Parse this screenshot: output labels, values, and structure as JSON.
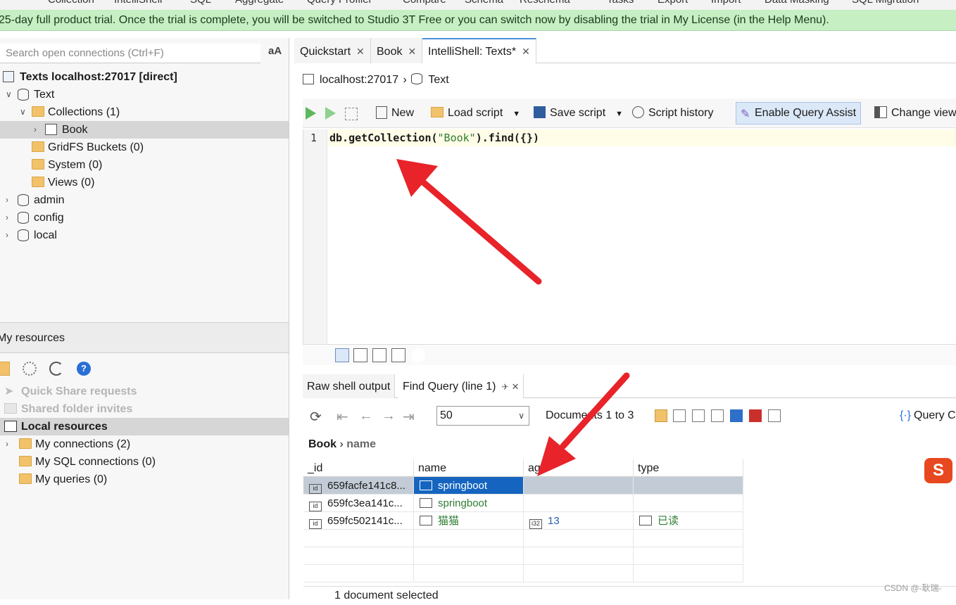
{
  "menubar": [
    "Collection",
    "IntelliShell",
    "SQL",
    "Aggregate",
    "Query Profiler",
    "Compare",
    "Schema",
    "Reschema",
    "Tasks",
    "Export",
    "Import",
    "Data Masking",
    "SQL Migration"
  ],
  "trial_banner": "25-day full product trial. Once the trial is complete, you will be switched to Studio 3T Free or you can switch now by disabling the trial in My License (in the Help Menu).",
  "search": {
    "placeholder": "Search open connections (Ctrl+F)",
    "aa_label": "aA"
  },
  "tree": {
    "connection": "Texts localhost:27017 [direct]",
    "db_text": "Text",
    "collections": "Collections (1)",
    "book": "Book",
    "gridfs": "GridFS Buckets (0)",
    "system": "System (0)",
    "views": "Views (0)",
    "admin": "admin",
    "config": "config",
    "local": "local"
  },
  "resources": {
    "title": "My resources",
    "quick_share": "Quick Share requests",
    "shared_folder": "Shared folder invites",
    "local_resources": "Local resources",
    "my_connections": "My connections (2)",
    "my_sql": "My SQL connections (0)",
    "my_queries": "My queries (0)"
  },
  "tabs": [
    "Quickstart",
    "Book",
    "IntelliShell: Texts*"
  ],
  "breadcrumb": {
    "host": "localhost:27017",
    "db": "Text"
  },
  "toolbar": {
    "new": "New",
    "load_script": "Load script",
    "save_script": "Save script",
    "script_history": "Script history",
    "enable_query_assist": "Enable Query Assist",
    "change_view": "Change view"
  },
  "editor": {
    "line_number": "1",
    "code_prefix": "db.getCollection(",
    "code_string": "\"Book\"",
    "code_suffix": ").find({})"
  },
  "results": {
    "tabs": [
      "Raw shell output",
      "Find Query (line 1)"
    ],
    "page_size": "50",
    "doc_count": "Documents 1 to 3",
    "query_code": "Query Code",
    "breadcrumb_root": "Book",
    "breadcrumb_field": "name",
    "columns": [
      "_id",
      "name",
      "age",
      "type"
    ],
    "rows": [
      {
        "id": "659facfe141c8...",
        "name": "springboot",
        "age": "",
        "type": ""
      },
      {
        "id": "659fc3ea141c...",
        "name": "springboot",
        "age": "",
        "type": ""
      },
      {
        "id": "659fc502141c...",
        "name": "猫猫",
        "age": "13",
        "type": "已读"
      }
    ],
    "status": "1 document selected"
  },
  "watermark": "CSDN @-耿瑞-",
  "colors": {
    "trial_bg": "#c6efc4",
    "selection": "#1565c0",
    "row_selected": "#c3ccd6",
    "string_value": "#2e7d32",
    "arrow": "#e8232a"
  }
}
